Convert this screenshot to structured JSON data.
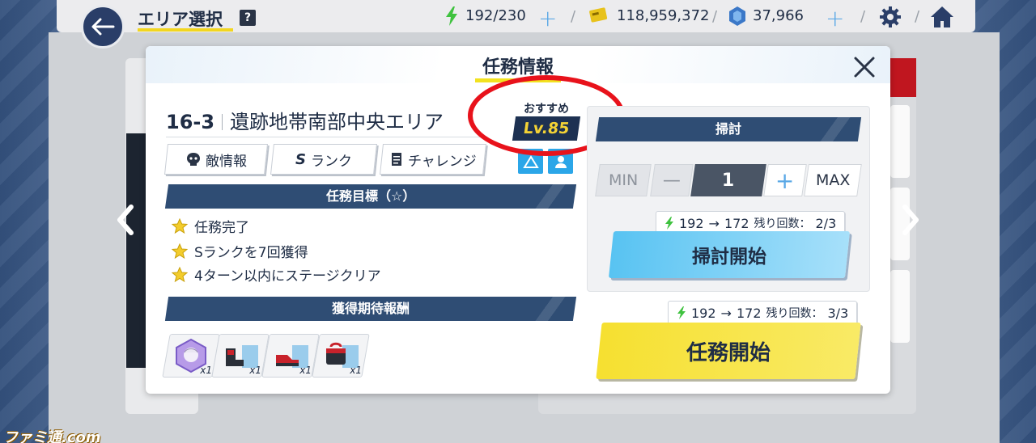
{
  "header": {
    "area_title": "エリア選択",
    "help_label": "?",
    "stamina": "192/230",
    "credits": "118,959,372",
    "gems": "37,966"
  },
  "modal": {
    "title": "任務情報",
    "stage_number": "16-3",
    "stage_name": "遺跡地帯南部中央エリア",
    "recommended_label": "おすすめ",
    "recommended_level": "Lv.85",
    "tabs": [
      {
        "label": "敵情報",
        "icon": "enemy-icon"
      },
      {
        "label": "ランク",
        "icon": "rank-s-icon"
      },
      {
        "label": "チャレンジ",
        "icon": "document-icon"
      }
    ],
    "objectives_header": "任務目標（☆）",
    "objectives": [
      "任務完了",
      "Sランクを7回獲得",
      "4ターン以内にステージクリア"
    ],
    "rewards_header": "獲得期待報酬",
    "rewards": [
      {
        "name": "character-shard",
        "count": "x1"
      },
      {
        "name": "gear-boots",
        "count": "x1"
      },
      {
        "name": "gear-shoes",
        "count": "x1"
      },
      {
        "name": "gear-bag",
        "count": "x1"
      }
    ],
    "sweep": {
      "header": "掃討",
      "min_label": "MIN",
      "minus_label": "—",
      "value": "1",
      "plus_label": "+",
      "max_label": "MAX",
      "cost_from": "192",
      "cost_to": "172",
      "remaining_label": "残り回数：",
      "remaining": "2/3",
      "button_label": "掃討開始"
    },
    "start": {
      "cost_from": "192",
      "cost_to": "172",
      "remaining_label": "残り回数：",
      "remaining": "3/3",
      "button_label": "任務開始"
    }
  },
  "watermark": "ファミ通.com",
  "colors": {
    "navy": "#2f4d74",
    "accent_blue": "#58c3f2",
    "accent_yellow": "#f6e030",
    "highlight_red": "#e8121b",
    "stamina_green": "#3fc23f"
  }
}
